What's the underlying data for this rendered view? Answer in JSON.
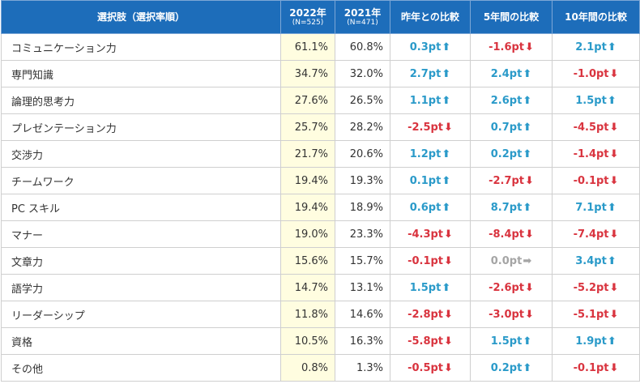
{
  "header": {
    "choice": "選択肢（選択率順）",
    "y2022": "2022年",
    "y2022_n": "(N=525)",
    "y2021": "2021年",
    "y2021_n": "(N=471)",
    "vs_last_year": "昨年との比較",
    "vs_5yr": "5年間の比較",
    "vs_10yr": "10年間の比較"
  },
  "rows": [
    {
      "label": "コミュニケーション力",
      "y2022": "61.1%",
      "y2021": "60.8%",
      "d1": "0.3pt",
      "d1dir": "up",
      "d5": "-1.6pt",
      "d5dir": "down",
      "d10": "2.1pt",
      "d10dir": "up"
    },
    {
      "label": "専門知識",
      "y2022": "34.7%",
      "y2021": "32.0%",
      "d1": "2.7pt",
      "d1dir": "up",
      "d5": "2.4pt",
      "d5dir": "up",
      "d10": "-1.0pt",
      "d10dir": "down"
    },
    {
      "label": "論理的思考力",
      "y2022": "27.6%",
      "y2021": "26.5%",
      "d1": "1.1pt",
      "d1dir": "up",
      "d5": "2.6pt",
      "d5dir": "up",
      "d10": "1.5pt",
      "d10dir": "up"
    },
    {
      "label": "プレゼンテーション力",
      "y2022": "25.7%",
      "y2021": "28.2%",
      "d1": "-2.5pt",
      "d1dir": "down",
      "d5": "0.7pt",
      "d5dir": "up",
      "d10": "-4.5pt",
      "d10dir": "down"
    },
    {
      "label": "交渉力",
      "y2022": "21.7%",
      "y2021": "20.6%",
      "d1": "1.2pt",
      "d1dir": "up",
      "d5": "0.2pt",
      "d5dir": "up",
      "d10": "-1.4pt",
      "d10dir": "down"
    },
    {
      "label": "チームワーク",
      "y2022": "19.4%",
      "y2021": "19.3%",
      "d1": "0.1pt",
      "d1dir": "up",
      "d5": "-2.7pt",
      "d5dir": "down",
      "d10": "-0.1pt",
      "d10dir": "down"
    },
    {
      "label": "PC スキル",
      "y2022": "19.4%",
      "y2021": "18.9%",
      "d1": "0.6pt",
      "d1dir": "up",
      "d5": "8.7pt",
      "d5dir": "up",
      "d10": "7.1pt",
      "d10dir": "up"
    },
    {
      "label": "マナー",
      "y2022": "19.0%",
      "y2021": "23.3%",
      "d1": "-4.3pt",
      "d1dir": "down",
      "d5": "-8.4pt",
      "d5dir": "down",
      "d10": "-7.4pt",
      "d10dir": "down"
    },
    {
      "label": "文章力",
      "y2022": "15.6%",
      "y2021": "15.7%",
      "d1": "-0.1pt",
      "d1dir": "down",
      "d5": "0.0pt",
      "d5dir": "flat",
      "d10": "3.4pt",
      "d10dir": "up"
    },
    {
      "label": "語学力",
      "y2022": "14.7%",
      "y2021": "13.1%",
      "d1": "1.5pt",
      "d1dir": "up",
      "d5": "-2.6pt",
      "d5dir": "down",
      "d10": "-5.2pt",
      "d10dir": "down"
    },
    {
      "label": "リーダーシップ",
      "y2022": "11.8%",
      "y2021": "14.6%",
      "d1": "-2.8pt",
      "d1dir": "down",
      "d5": "-3.0pt",
      "d5dir": "down",
      "d10": "-5.1pt",
      "d10dir": "down"
    },
    {
      "label": "資格",
      "y2022": "10.5%",
      "y2021": "16.3%",
      "d1": "-5.8pt",
      "d1dir": "down",
      "d5": "1.5pt",
      "d5dir": "up",
      "d10": "1.9pt",
      "d10dir": "up"
    },
    {
      "label": "その他",
      "y2022": "0.8%",
      "y2021": "1.3%",
      "d1": "-0.5pt",
      "d1dir": "down",
      "d5": "0.2pt",
      "d5dir": "up",
      "d10": "-0.1pt",
      "d10dir": "down"
    }
  ],
  "icons": {
    "up": "arrow-up-icon",
    "down": "arrow-down-icon",
    "flat": "arrow-right-icon"
  },
  "colors": {
    "header_bg": "#1d6dba",
    "highlight_bg": "#fffde0",
    "up": "#2a9ac9",
    "down": "#d9343f",
    "flat": "#a5a5a5"
  }
}
